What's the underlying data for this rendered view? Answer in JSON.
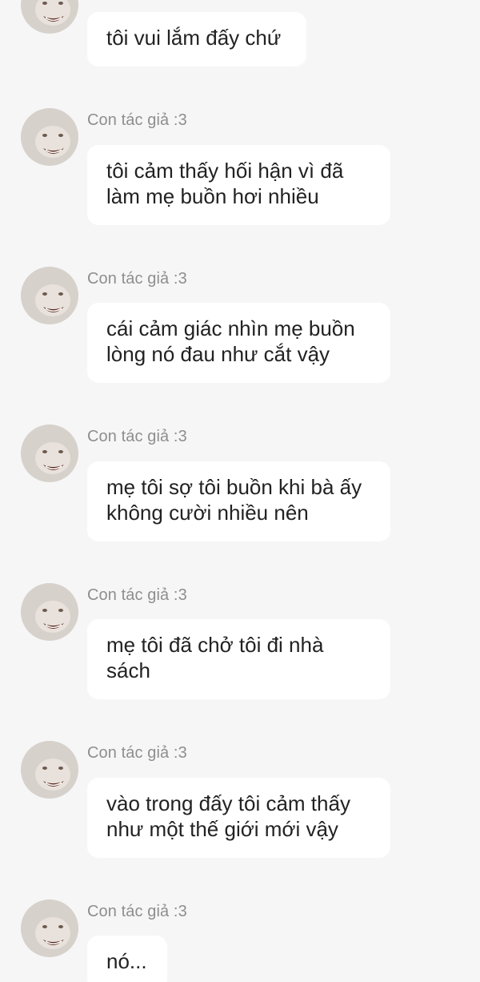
{
  "messages": [
    {
      "sender": "",
      "text": "tôi vui lắm đấy chứ",
      "avatar_icon": "author-avatar-icon"
    },
    {
      "sender": "Con tác giả :3",
      "text": "tôi cảm thấy hối hận vì đã\nlàm mẹ buồn hơi nhiều",
      "avatar_icon": "author-avatar-icon"
    },
    {
      "sender": "Con tác giả :3",
      "text": "cái cảm giác nhìn mẹ buồn\nlòng nó đau như cắt vậy",
      "avatar_icon": "author-avatar-icon"
    },
    {
      "sender": "Con tác giả :3",
      "text": "mẹ tôi sợ tôi buồn khi bà ấy\nkhông cười nhiều nên",
      "avatar_icon": "author-avatar-icon"
    },
    {
      "sender": "Con tác giả :3",
      "text": "mẹ tôi đã chở tôi đi nhà\nsách",
      "avatar_icon": "author-avatar-icon"
    },
    {
      "sender": "Con tác giả :3",
      "text": "vào trong đấy tôi cảm thấy\nnhư một thế giới mới vậy",
      "avatar_icon": "author-avatar-icon"
    },
    {
      "sender": "Con tác giả :3",
      "text": "nó...",
      "avatar_icon": "author-avatar-icon"
    }
  ],
  "colors": {
    "background": "#f6f6f6",
    "bubble": "#ffffff",
    "sender_text": "#8e8e8e",
    "message_text": "#222222"
  }
}
